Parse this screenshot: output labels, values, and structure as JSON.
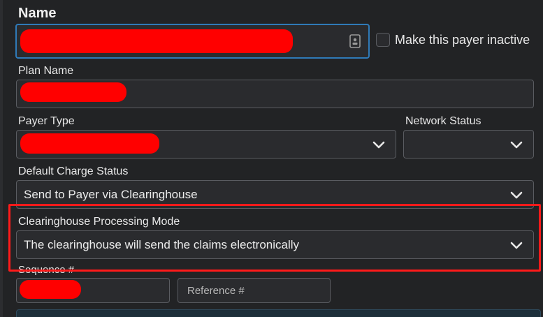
{
  "name": {
    "label": "Name"
  },
  "inactive": {
    "label": "Make this payer inactive"
  },
  "plan": {
    "label": "Plan Name"
  },
  "payer_type": {
    "label": "Payer Type"
  },
  "network_status": {
    "label": "Network Status"
  },
  "default_charge_status": {
    "label": "Default Charge Status",
    "value": "Send to Payer via Clearinghouse"
  },
  "clearinghouse_mode": {
    "label": "Clearinghouse Processing Mode",
    "value": "The clearinghouse will send the claims electronically"
  },
  "sequence": {
    "label": "Sequence #"
  },
  "reference": {
    "placeholder": "Reference #"
  },
  "colors": {
    "highlight": "#ff1a1a",
    "focus_border": "#2f7ab8",
    "redaction": "#ff0000"
  },
  "icons": [
    "contact-card-icon",
    "chevron-down-icon"
  ]
}
